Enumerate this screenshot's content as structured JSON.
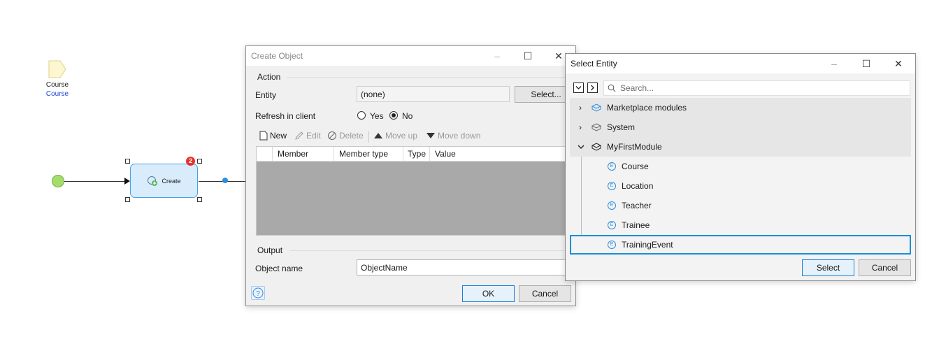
{
  "canvas": {
    "parameter": {
      "name": "Course",
      "type": "Course"
    },
    "activity": {
      "label": "Create",
      "error_count": "2"
    }
  },
  "create_object": {
    "title": "Create Object",
    "action_group": "Action",
    "entity_label": "Entity",
    "entity_value": "(none)",
    "select_button": "Select...",
    "refresh_label": "Refresh in client",
    "refresh_options": [
      "Yes",
      "No"
    ],
    "refresh_selected": "No",
    "toolbar": {
      "new": "New",
      "edit": "Edit",
      "delete": "Delete",
      "move_up": "Move up",
      "move_down": "Move down"
    },
    "columns": [
      "Member",
      "Member type",
      "Type",
      "Value"
    ],
    "output_group": "Output",
    "object_name_label": "Object name",
    "object_name_value": "ObjectName",
    "ok_button": "OK",
    "cancel_button": "Cancel"
  },
  "select_entity": {
    "title": "Select Entity",
    "search_placeholder": "Search...",
    "modules": [
      {
        "name": "Marketplace modules",
        "expanded": false
      },
      {
        "name": "System",
        "expanded": false
      },
      {
        "name": "MyFirstModule",
        "expanded": true
      }
    ],
    "entities": [
      "Course",
      "Location",
      "Teacher",
      "Trainee",
      "TrainingEvent"
    ],
    "selected_entity": "TrainingEvent",
    "select_button": "Select",
    "cancel_button": "Cancel"
  },
  "colors": {
    "accent": "#1a8fd5",
    "start_event": "#a6dc6b",
    "error_badge": "#e8322e"
  }
}
